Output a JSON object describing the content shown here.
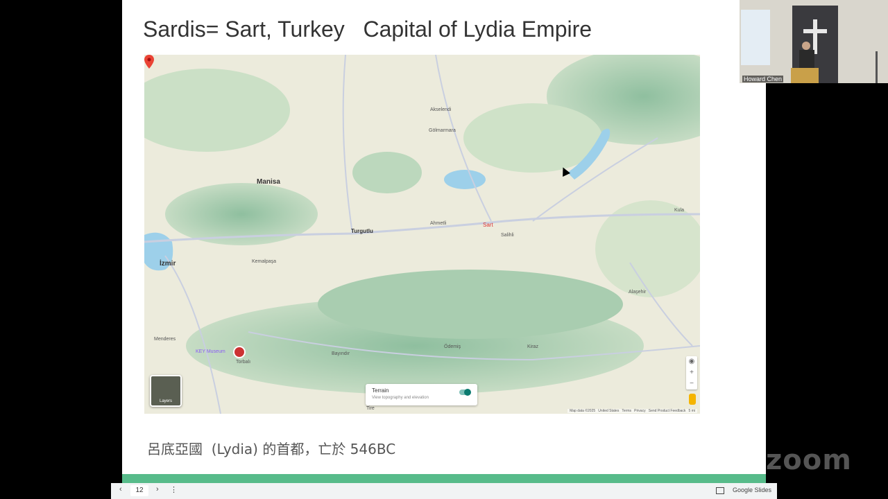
{
  "slide": {
    "title": "Sardis= Sart, Turkey   Capital of Lydia Empire",
    "subtitle": "呂底亞國  (Lydia) 的首都，亡於 546BC"
  },
  "map": {
    "pin_label": "Sart",
    "cities": {
      "izmir": "İzmir",
      "manisa": "Manisa",
      "turgutlu": "Turgutlu",
      "salihli": "Salihli",
      "alasehir": "Alaşehir",
      "odemis": "Ödemiş",
      "menderes": "Menderes",
      "torbali": "Torbalı",
      "kula": "Kula",
      "ahmetli": "Ahmetli",
      "akhisar": "Akselendi",
      "golmarmara": "Gölmarmara",
      "kemalpasa": "Kemalpaşa",
      "bayindir": "Bayındır",
      "kiraz": "Kiraz",
      "tire": "Tire"
    },
    "museum_label": "KEY Museum",
    "layers_label": "Layers",
    "terrain_title": "Terrain",
    "terrain_desc": "View topography and elevation",
    "terrain_enabled": true,
    "attribution": "Map data ©2025   United States   Terms   Privacy   Send Product Feedback   5 mi"
  },
  "toolbar": {
    "page_number": "12",
    "prev_icon": "‹",
    "next_icon": "›",
    "menu_icon": "⋮",
    "app_name": "Google Slides"
  },
  "video": {
    "participant_name": "Howard Chen"
  },
  "branding": {
    "zoom_logo": "zoom"
  },
  "colors": {
    "accent_bar": "#57bb8a",
    "pin": "#ea4335"
  }
}
